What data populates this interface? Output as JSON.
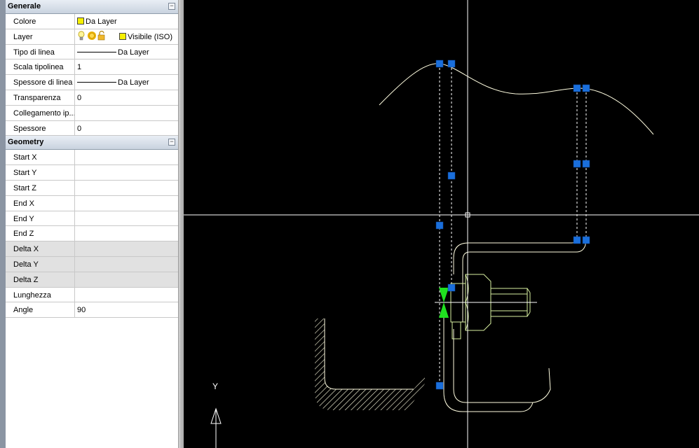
{
  "properties": {
    "general": {
      "title": "Generale",
      "collapse_symbol": "−",
      "rows": [
        {
          "name": "Colore",
          "value": "Da Layer"
        },
        {
          "name": "Layer",
          "value": "Visibile (ISO)"
        },
        {
          "name": "Tipo di linea",
          "value": "Da Layer"
        },
        {
          "name": "Scala tipolinea",
          "value": "1"
        },
        {
          "name": "Spessore di linea",
          "value": "Da Layer"
        },
        {
          "name": "Transparenza",
          "value": "0"
        },
        {
          "name": "Collegamento ip...",
          "value": ""
        },
        {
          "name": "Spessore",
          "value": "0"
        }
      ]
    },
    "geometry": {
      "title": "Geometry",
      "collapse_symbol": "−",
      "rows": [
        {
          "name": "Start X",
          "value": ""
        },
        {
          "name": "Start Y",
          "value": ""
        },
        {
          "name": "Start Z",
          "value": ""
        },
        {
          "name": "End X",
          "value": ""
        },
        {
          "name": "End Y",
          "value": ""
        },
        {
          "name": "End Z",
          "value": ""
        },
        {
          "name": "Delta X",
          "value": ""
        },
        {
          "name": "Delta Y",
          "value": ""
        },
        {
          "name": "Delta Z",
          "value": ""
        },
        {
          "name": "Lunghezza",
          "value": ""
        },
        {
          "name": "Angle",
          "value": "90"
        }
      ]
    }
  },
  "layer_icons": [
    "lightbulb-icon",
    "sun-freeze-icon",
    "lock-icon",
    "color-swatch-icon"
  ],
  "colors": {
    "viewport_bg": "#000000",
    "grip": "#1a6fdc",
    "crosshair": "#ffffff",
    "geometry_line": "#fffde0",
    "selected_outline": "#d8f0a0",
    "green_marker": "#20e020",
    "layer_swatch": "#f6f000"
  },
  "ucs": {
    "axis_label": "Y"
  }
}
